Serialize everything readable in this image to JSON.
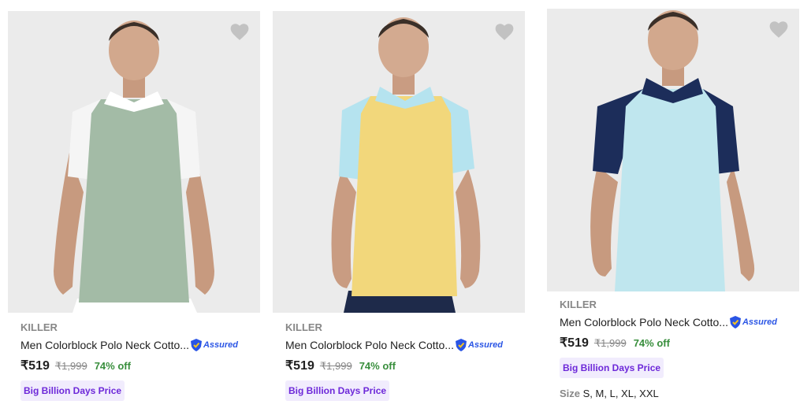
{
  "products": [
    {
      "brand": "KILLER",
      "title": "Men Colorblock Polo Neck Cotto...",
      "assured": "Assured",
      "price": "₹519",
      "mrp": "₹1,999",
      "discount": "74% off",
      "badge": "Big Billion Days Price",
      "image": {
        "body": "#a3bba6",
        "sleeves": "#f5f5f5",
        "collar": "#ffffff",
        "pants": "#ffffff"
      }
    },
    {
      "brand": "KILLER",
      "title": "Men Colorblock Polo Neck Cotto...",
      "assured": "Assured",
      "price": "₹519",
      "mrp": "₹1,999",
      "discount": "74% off",
      "badge": "Big Billion Days Price",
      "image": {
        "body": "#f2d77b",
        "sleeves": "#b5e3ef",
        "collar": "#b5e3ef",
        "pants": "#1e2a4a"
      }
    },
    {
      "brand": "KILLER",
      "title": "Men Colorblock Polo Neck Cotto...",
      "assured": "Assured",
      "price": "₹519",
      "mrp": "₹1,999",
      "discount": "74% off",
      "badge": "Big Billion Days Price",
      "size_label": "Size",
      "sizes": "S, M, L, XL, XXL",
      "image": {
        "body": "#bfe6ee",
        "sleeves": "#1c2d5a",
        "collar": "#1c2d5a",
        "pants": "#bfe6ee"
      }
    }
  ],
  "colors": {
    "wishlist": "#c2c2c2",
    "discount": "#388e3c",
    "assured": "#2a55e5",
    "badge_bg": "#f1ecfd",
    "badge_text": "#6d28d9"
  }
}
